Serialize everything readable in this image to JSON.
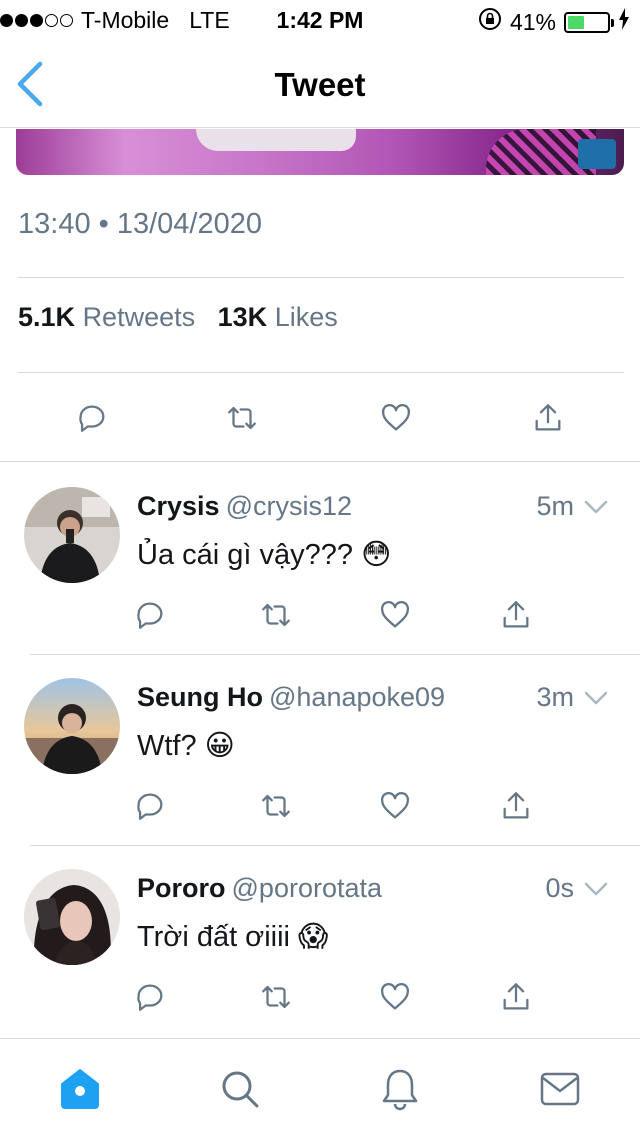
{
  "status_bar": {
    "carrier": "T-Mobile",
    "network": "LTE",
    "time": "1:42 PM",
    "battery": "41%",
    "battery_level": 0.41,
    "signal_bars": 3,
    "signal_total": 5,
    "icons": [
      "orientation-lock-icon",
      "charging-icon"
    ]
  },
  "nav": {
    "title": "Tweet",
    "back_icon": "chevron-left-icon",
    "accent": "#4aa8ef"
  },
  "tweet": {
    "timestamp": "13:40 • 13/04/2020",
    "retweets_count": "5.1K",
    "retweets_label": "Retweets",
    "likes_count": "13K",
    "likes_label": "Likes",
    "actions": [
      "reply-icon",
      "retweet-icon",
      "like-icon",
      "share-icon"
    ]
  },
  "replies": [
    {
      "name": "Crysis",
      "handle": "@crysis12",
      "time": "5m",
      "text": "Ủa cái gì vậy??? 😳"
    },
    {
      "name": "Seung Ho",
      "handle": "@hanapoke09",
      "time": "3m",
      "text": "Wtf? 😀"
    },
    {
      "name": "Pororo",
      "handle": "@pororotata",
      "time": "0s",
      "text": "Trời đất ơiiii 😱"
    }
  ],
  "tab_bar": {
    "tabs": [
      "home-icon",
      "search-icon",
      "notifications-icon",
      "messages-icon"
    ],
    "active": "home-icon",
    "active_color": "#1da1f2",
    "inactive_color": "#657786"
  }
}
